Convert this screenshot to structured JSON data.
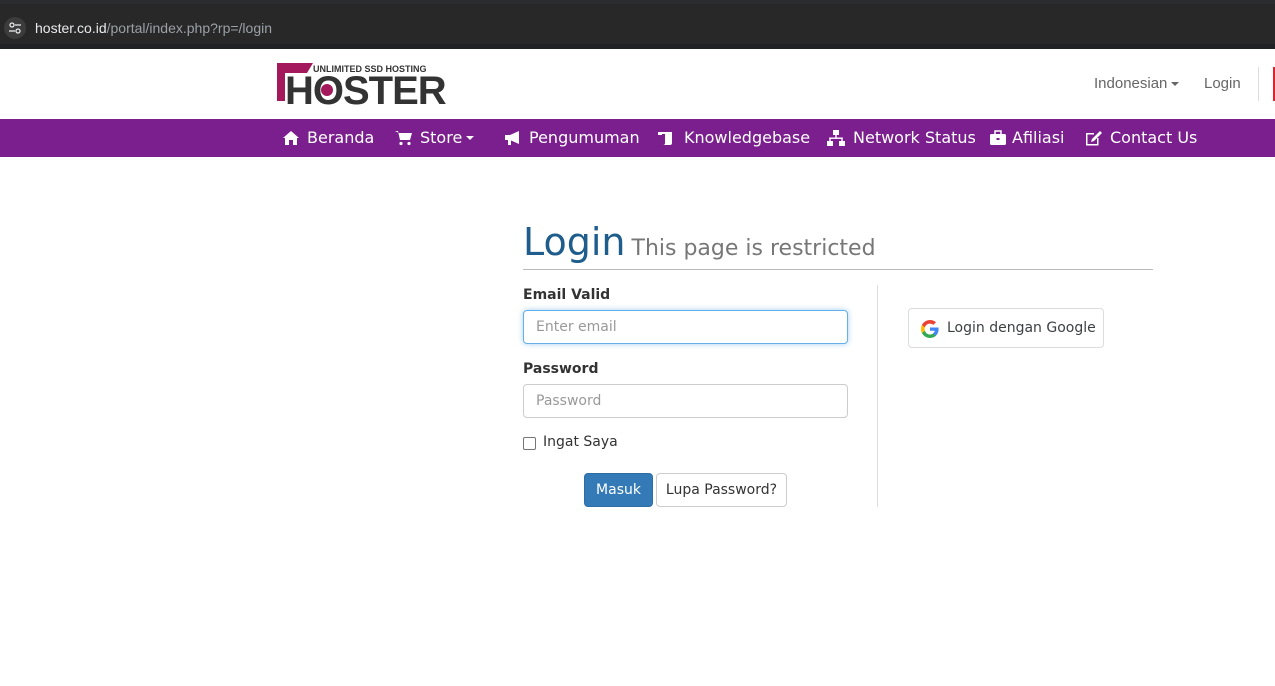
{
  "browser": {
    "url_host": "hoster.co.id",
    "url_path": "/portal/index.php?rp=/login"
  },
  "header": {
    "logo_tagline": "UNLIMITED SSD HOSTING",
    "logo_text": "HOSTER",
    "language": "Indonesian",
    "login_link": "Login"
  },
  "nav": {
    "items": [
      {
        "label": "Beranda",
        "icon": "home-icon"
      },
      {
        "label": "Store",
        "icon": "cart-icon"
      },
      {
        "label": "Pengumuman",
        "icon": "bullhorn-icon"
      },
      {
        "label": "Knowledgebase",
        "icon": "scroll-icon"
      },
      {
        "label": "Network Status",
        "icon": "network-icon"
      },
      {
        "label": "Afiliasi",
        "icon": "briefcase-icon"
      },
      {
        "label": "Contact Us",
        "icon": "edit-icon"
      }
    ]
  },
  "page": {
    "title": "Login",
    "subtitle": "This page is restricted"
  },
  "form": {
    "email_label": "Email Valid",
    "email_placeholder": "Enter email",
    "password_label": "Password",
    "password_placeholder": "Password",
    "remember_label": "Ingat Saya",
    "remember_checked": false,
    "submit_label": "Masuk",
    "forgot_label": "Lupa Password?"
  },
  "social": {
    "google_label": "Login dengan Google"
  },
  "colors": {
    "nav_bg": "#7b1f8e",
    "title": "#1f5d8c",
    "primary": "#337ab7"
  }
}
